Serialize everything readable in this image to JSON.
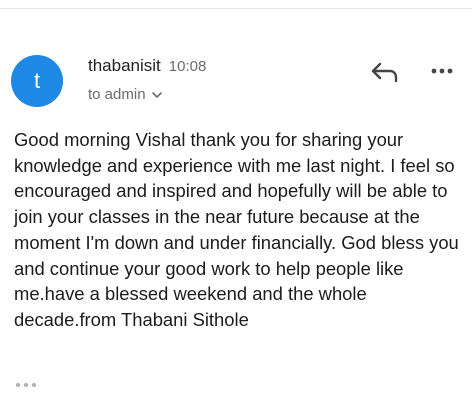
{
  "email": {
    "avatar_letter": "t",
    "avatar_color": "#1e88e5",
    "sender": "thabanisit",
    "time": "10:08",
    "recipient": "to admin",
    "body": "Good morning Vishal thank you for sharing your knowledge and experience with me last night. I feel so encouraged and inspired and hopefully will be able to join your classes in the near future because at the moment I'm down and under financially. God bless you and continue your good work to help people like me.have a blessed weekend and the whole decade.from Thabani Sithole"
  },
  "icons": {
    "reply": "reply-icon",
    "more": "more-options-icon",
    "recipient_expand": "chevron-down-icon",
    "trimmed_content": "ellipsis-icon"
  }
}
